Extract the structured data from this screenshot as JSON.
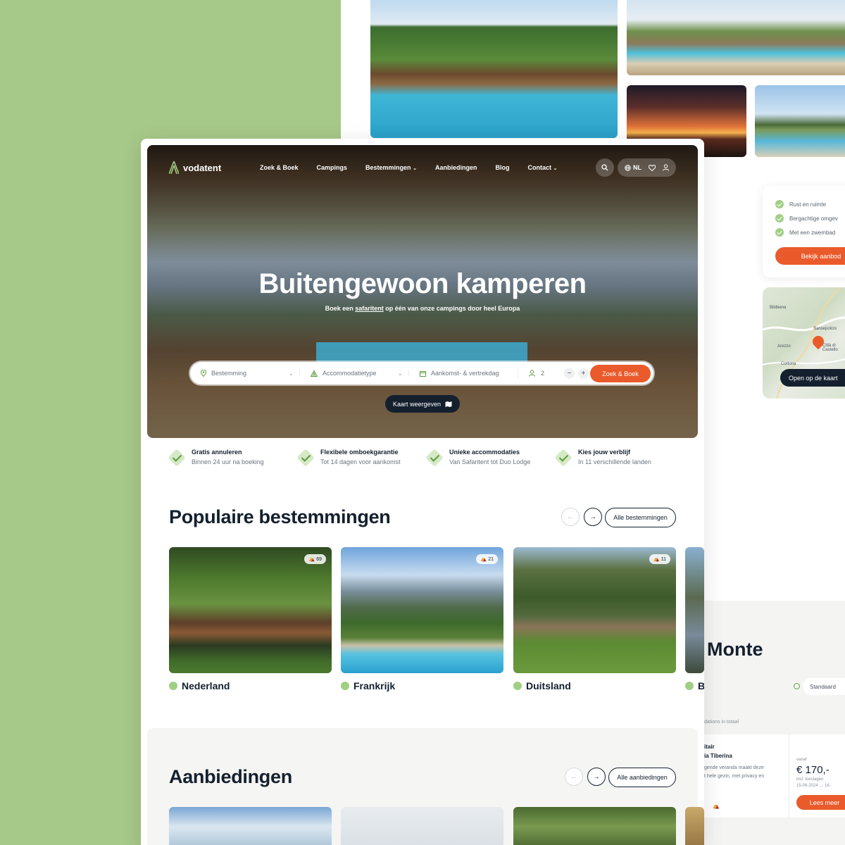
{
  "brand": {
    "name": "vodatent",
    "accent": "#ea5a2a",
    "green": "#9fcf84",
    "dark": "#14202e"
  },
  "nav": {
    "items": [
      "Zoek & Boek",
      "Campings",
      "Bestemmingen",
      "Aanbiedingen",
      "Blog",
      "Contact"
    ],
    "language": "NL"
  },
  "hero": {
    "title": "Buitengewoon kamperen",
    "subtitle_pre": "Boek een ",
    "subtitle_link": "safaritent",
    "subtitle_post": " op één van onze campings door heel Europa"
  },
  "search": {
    "destination_placeholder": "Bestemming",
    "accommodation_placeholder": "Accommodatietype",
    "dates_placeholder": "Aankomst- & vertrekdag",
    "guests": "2",
    "minus": "−",
    "plus": "+",
    "submit": "Zoek & Boek",
    "map_button": "Kaart weergeven"
  },
  "usps": [
    {
      "title": "Gratis annuleren",
      "text": "Binnen 24 uur na boeking"
    },
    {
      "title": "Flexibele omboekgarantie",
      "text": "Tot 14 dagen voor aankomst"
    },
    {
      "title": "Unieke accommodaties",
      "text": "Van Safaritent tot Duo Lodge"
    },
    {
      "title": "Kies jouw verblijf",
      "text": "In 11 verschillende landen"
    }
  ],
  "destinations": {
    "title": "Populaire bestemmingen",
    "all_button": "Alle bestemmingen",
    "prev": "←",
    "next": "→",
    "items": [
      {
        "name": "Nederland",
        "count": "69"
      },
      {
        "name": "Frankrijk",
        "count": "21"
      },
      {
        "name": "Duitsland",
        "count": "11"
      },
      {
        "name": "B",
        "count": ""
      }
    ]
  },
  "offers": {
    "title": "Aanbiedingen",
    "all_button": "Alle aanbiedingen",
    "prev": "←",
    "next": "→"
  },
  "side_card": {
    "features": [
      "Rust en ruimte",
      "Bergachtige omgev",
      "Met een zwembad"
    ],
    "cta": "Bekijk aanbod"
  },
  "map_card": {
    "places": [
      "Bibbiena",
      "Sansepolcro",
      "Arezzo",
      "Città di Castello",
      "Cortona"
    ],
    "cta": "Open op de kaart"
  },
  "detail_panel": {
    "heading": "Monte",
    "sort_label": "Standaard",
    "total": "dations in totaal",
    "title_line1": "itair",
    "title_line2": "ia Tiberina",
    "desc_line1": "gende veranda maakt deze",
    "desc_line2": "t hele gezin, met privacy en",
    "price_label": "vanaf",
    "price": "€ 170,-",
    "fees": "incl. toeslagen",
    "dates": "15-06-2024  →  16-",
    "cta": "Lees meer"
  }
}
